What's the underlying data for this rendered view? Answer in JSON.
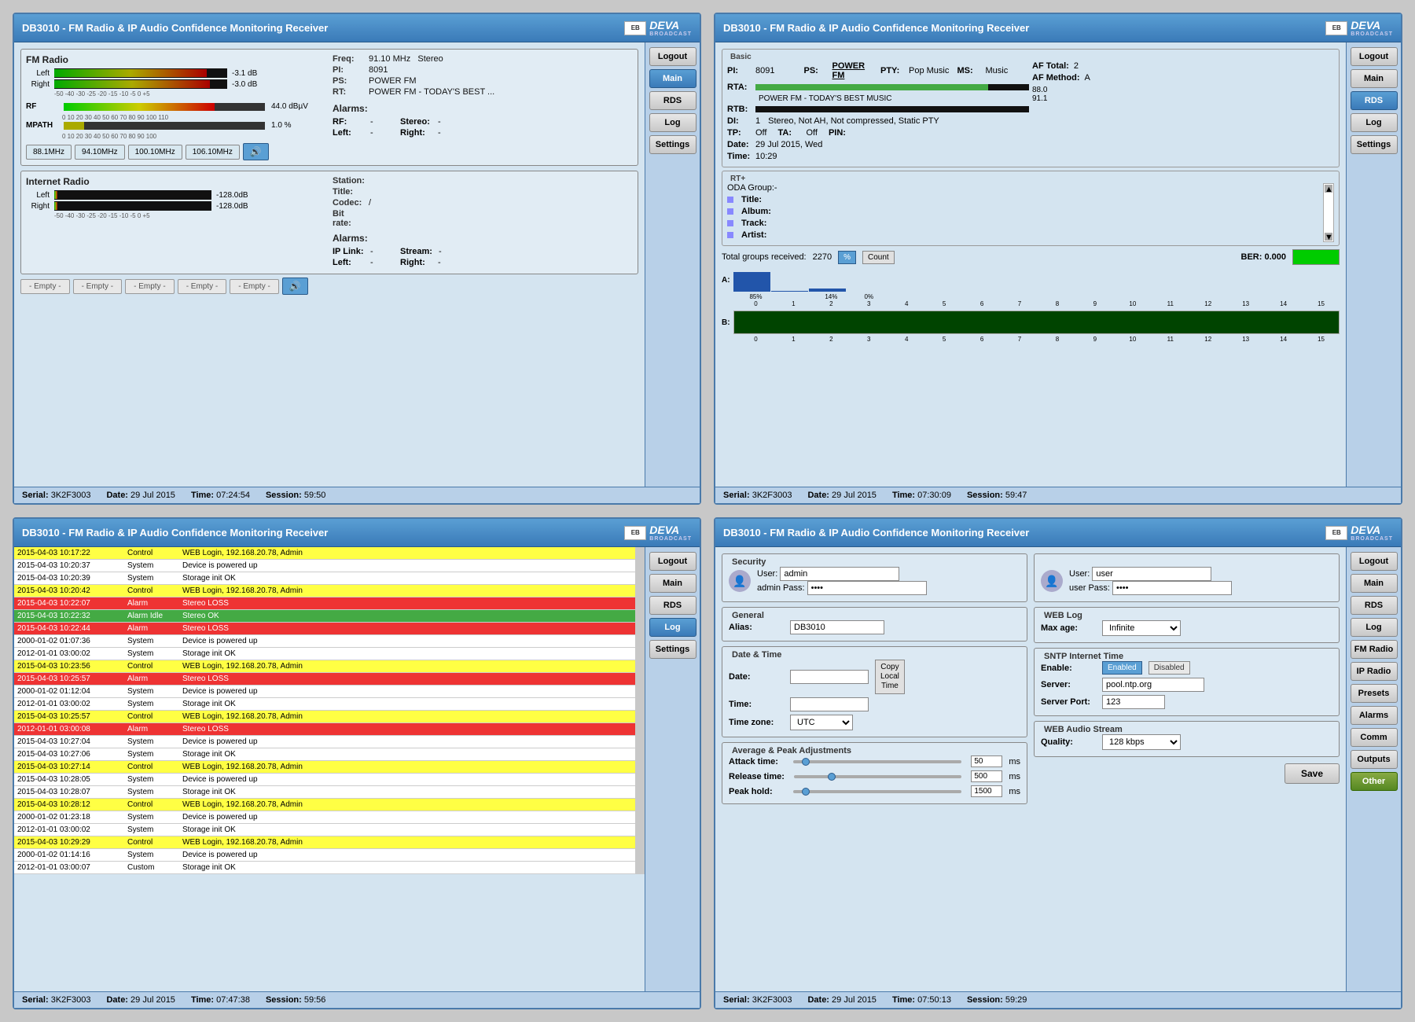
{
  "panels": {
    "panel1": {
      "title": "DB3010 - FM Radio & IP Audio Confidence Monitoring Receiver",
      "fm_radio": {
        "title": "FM Radio",
        "left_label": "Left",
        "right_label": "Right",
        "left_db": "-3.1 dB",
        "right_db": "-3.0 dB",
        "scale": "-50  -40  -30  -25  -20  -15  -10  -5  0  +5",
        "rf_label": "RF",
        "rf_value": "44.0 dBµV",
        "mpath_label": "MPATH",
        "mpath_value": "1.0 %",
        "rf_scale": "0  10  20  30  40  50  60  70  80  90  100  110",
        "mpath_scale": "0  10  20  30  40  50  60  70  80  90  100"
      },
      "freq_info": {
        "freq_label": "Freq:",
        "freq_val": "91.10 MHz",
        "stereo": "Stereo",
        "pi_label": "PI:",
        "pi_val": "8091",
        "ps_label": "PS:",
        "ps_val": "POWER FM",
        "rt_label": "RT:",
        "rt_val": "POWER FM - TODAY'S BEST ..."
      },
      "alarms": {
        "title": "Alarms:",
        "rf_label": "RF:",
        "rf_val": "-",
        "stereo_label": "Stereo:",
        "stereo_val": "-",
        "left_label": "Left:",
        "left_val": "-",
        "right_label": "Right:",
        "right_val": "-"
      },
      "freqs": [
        "88.1MHz",
        "94.10MHz",
        "100.10MHz",
        "106.10MHz"
      ],
      "internet_radio": {
        "title": "Internet Radio",
        "left_label": "Left",
        "right_label": "Right",
        "left_db": "-128.0dB",
        "right_db": "-128.0dB",
        "title_label": "Title:",
        "title_val": "",
        "codec_label": "Codec:",
        "codec_val": "/",
        "bitrate_label": "Bit rate:",
        "bitrate_val": "",
        "station_label": "Station:",
        "station_val": ""
      },
      "internet_alarms": {
        "title": "Alarms:",
        "iplink_label": "IP Link:",
        "iplink_val": "-",
        "stream_label": "Stream:",
        "stream_val": "-",
        "left_label": "Left:",
        "left_val": "-",
        "right_label": "Right:",
        "right_val": "-"
      },
      "empty_btns": [
        "- Empty -",
        "- Empty -",
        "- Empty -",
        "- Empty -",
        "- Empty -"
      ],
      "footer": {
        "serial_label": "Serial:",
        "serial_val": "3K2F3003",
        "date_label": "Date:",
        "date_val": "29 Jul 2015",
        "time_label": "Time:",
        "time_val": "07:24:54",
        "session_label": "Session:",
        "session_val": "59:50"
      },
      "sidebar": [
        "Logout",
        "Main",
        "RDS",
        "Log",
        "Settings"
      ]
    },
    "panel2": {
      "title": "DB3010 - FM Radio & IP Audio Confidence Monitoring Receiver",
      "basic": {
        "legend": "Basic",
        "pi_label": "PI:",
        "pi_val": "8091",
        "ps_label": "PS:",
        "ps_val": "POWER FM",
        "pty_label": "PTY:",
        "pty_val": "Pop Music",
        "ms_label": "MS:",
        "ms_val": "Music",
        "af_total_label": "AF Total:",
        "af_total_val": "2",
        "af_method_label": "AF Method:",
        "af_method_val": "A",
        "rta_label": "RTA:",
        "rta_val": "POWER FM - TODAY'S BEST MUSIC",
        "rtb_label": "RTB:",
        "rtb_val": "",
        "af1_val": "88.0",
        "af2_val": "91.1",
        "di_label": "DI:",
        "di_val": "1",
        "di_desc": "Stereo, Not AH, Not compressed, Static PTY",
        "tp_label": "TP:",
        "tp_val": "Off",
        "ta_label": "TA:",
        "ta_val": "Off",
        "pin_label": "PIN:",
        "pin_val": "",
        "date_label": "Date:",
        "date_val": "29 Jul 2015, Wed",
        "time_label": "Time:",
        "time_val": "10:29"
      },
      "rt_plus": {
        "legend": "RT+",
        "oda_label": "ODA Group:-",
        "title_label": "Title:",
        "title_val": "",
        "album_label": "Album:",
        "album_val": "",
        "track_label": "Track:",
        "track_val": "",
        "artist_label": "Artist:",
        "artist_val": ""
      },
      "groups": {
        "total_label": "Total groups received:",
        "total_val": "2270",
        "pct_btn": "%",
        "count_btn": "Count",
        "a_label": "A:",
        "a_bars": [
          85,
          0,
          14,
          0,
          0,
          0,
          0,
          0,
          0,
          0,
          0,
          0,
          0,
          0,
          0,
          0
        ],
        "a_labels": [
          "0",
          "1",
          "2",
          "3",
          "4",
          "5",
          "6",
          "7",
          "8",
          "9",
          "10",
          "11",
          "12",
          "13",
          "14",
          "15"
        ],
        "b_label": "B:",
        "b_bars": [
          0,
          0,
          0,
          0,
          0,
          0,
          0,
          0,
          0,
          0,
          0,
          0,
          0,
          0,
          0,
          0
        ],
        "ber_label": "BER:",
        "ber_val": "0.000"
      },
      "footer": {
        "serial_label": "Serial:",
        "serial_val": "3K2F3003",
        "date_label": "Date:",
        "date_val": "29 Jul 2015",
        "time_label": "Time:",
        "time_val": "07:30:09",
        "session_label": "Session:",
        "session_val": "59:47"
      },
      "sidebar": [
        "Logout",
        "Main",
        "RDS",
        "Log",
        "Settings"
      ]
    },
    "panel3": {
      "title": "DB3010 - FM Radio & IP Audio Confidence Monitoring Receiver",
      "log_entries": [
        {
          "date": "2015-04-03 10:17:22",
          "type": "Control",
          "msg": "WEB Login, 192.168.20.78, Admin",
          "color": "yellow"
        },
        {
          "date": "2015-04-03 10:20:37",
          "type": "System",
          "msg": "Device is powered up",
          "color": "normal"
        },
        {
          "date": "2015-04-03 10:20:39",
          "type": "System",
          "msg": "Storage init OK",
          "color": "normal"
        },
        {
          "date": "2015-04-03 10:20:42",
          "type": "Control",
          "msg": "WEB Login, 192.168.20.78, Admin",
          "color": "yellow"
        },
        {
          "date": "2015-04-03 10:22:07",
          "type": "Alarm",
          "msg": "Stereo LOSS",
          "color": "red"
        },
        {
          "date": "2015-04-03 10:22:32",
          "type": "Alarm Idle",
          "msg": "Stereo OK",
          "color": "green"
        },
        {
          "date": "2015-04-03 10:22:44",
          "type": "Alarm",
          "msg": "Stereo LOSS",
          "color": "red"
        },
        {
          "date": "2000-01-02 01:07:36",
          "type": "System",
          "msg": "Device is powered up",
          "color": "normal"
        },
        {
          "date": "2012-01-01 03:00:02",
          "type": "System",
          "msg": "Storage init OK",
          "color": "normal"
        },
        {
          "date": "2015-04-03 10:23:56",
          "type": "Control",
          "msg": "WEB Login, 192.168.20.78, Admin",
          "color": "yellow"
        },
        {
          "date": "2015-04-03 10:25:57",
          "type": "Alarm",
          "msg": "Stereo LOSS",
          "color": "red"
        },
        {
          "date": "2000-01-02 01:12:04",
          "type": "System",
          "msg": "Device is powered up",
          "color": "normal"
        },
        {
          "date": "2012-01-01 03:00:02",
          "type": "System",
          "msg": "Storage init OK",
          "color": "normal"
        },
        {
          "date": "2015-04-03 10:25:57",
          "type": "Control",
          "msg": "WEB Login, 192.168.20.78, Admin",
          "color": "yellow"
        },
        {
          "date": "2012-01-01 03:00:08",
          "type": "Alarm",
          "msg": "Stereo LOSS",
          "color": "red"
        },
        {
          "date": "2015-04-03 10:27:04",
          "type": "System",
          "msg": "Device is powered up",
          "color": "normal"
        },
        {
          "date": "2015-04-03 10:27:06",
          "type": "System",
          "msg": "Storage init OK",
          "color": "normal"
        },
        {
          "date": "2015-04-03 10:27:14",
          "type": "Control",
          "msg": "WEB Login, 192.168.20.78, Admin",
          "color": "yellow"
        },
        {
          "date": "2015-04-03 10:28:05",
          "type": "System",
          "msg": "Device is powered up",
          "color": "normal"
        },
        {
          "date": "2015-04-03 10:28:07",
          "type": "System",
          "msg": "Storage init OK",
          "color": "normal"
        },
        {
          "date": "2015-04-03 10:28:12",
          "type": "Control",
          "msg": "WEB Login, 192.168.20.78, Admin",
          "color": "yellow"
        },
        {
          "date": "2000-01-02 01:23:18",
          "type": "System",
          "msg": "Device is powered up",
          "color": "normal"
        },
        {
          "date": "2012-01-01 03:00:02",
          "type": "System",
          "msg": "Storage init OK",
          "color": "normal"
        },
        {
          "date": "2015-04-03 10:29:29",
          "type": "Control",
          "msg": "WEB Login, 192.168.20.78, Admin",
          "color": "yellow"
        },
        {
          "date": "2000-01-02 01:14:16",
          "type": "System",
          "msg": "Device is powered up",
          "color": "normal"
        },
        {
          "date": "2012-01-01 03:00:07",
          "type": "Custom",
          "msg": "Storage init OK",
          "color": "normal"
        }
      ],
      "footer": {
        "serial_label": "Serial:",
        "serial_val": "3K2F3003",
        "date_label": "Date:",
        "date_val": "29 Jul 2015",
        "time_label": "Time:",
        "time_val": "07:47:38",
        "session_label": "Session:",
        "session_val": "59:56"
      },
      "sidebar": [
        "Logout",
        "Main",
        "RDS",
        "Log",
        "Settings"
      ]
    },
    "panel4": {
      "title": "DB3010 - FM Radio & IP Audio Confidence Monitoring Receiver",
      "security": {
        "legend": "Security",
        "user1_label": "User:",
        "user1_val": "admin",
        "user2_label": "User:",
        "user2_val": "user",
        "pass1_label": "admin Pass:",
        "pass1_val": "••••",
        "pass2_label": "user Pass:",
        "pass2_val": "••••"
      },
      "general": {
        "legend": "General",
        "alias_label": "Alias:",
        "alias_val": "DB3010"
      },
      "web_log": {
        "legend": "WEB Log",
        "maxage_label": "Max age:",
        "maxage_val": "Infinite"
      },
      "date_time": {
        "legend": "Date & Time",
        "date_label": "Date:",
        "date_val": "",
        "time_label": "Time:",
        "time_val": "",
        "timezone_label": "Time zone:",
        "timezone_val": "UTC",
        "copy_btn": "Copy",
        "local_btn": "Local",
        "time_btn": "Time"
      },
      "sntp": {
        "legend": "SNTP Internet Time",
        "enable_label": "Enable:",
        "enabled_btn": "Enabled",
        "disabled_btn": "Disabled",
        "server_label": "Server:",
        "server_val": "pool.ntp.org",
        "port_label": "Server Port:",
        "port_val": "123"
      },
      "avg_peak": {
        "legend": "Average & Peak Adjustments",
        "attack_label": "Attack time:",
        "attack_val": "50",
        "attack_unit": "ms",
        "release_label": "Release time:",
        "release_val": "500",
        "release_unit": "ms",
        "peak_label": "Peak hold:",
        "peak_val": "1500",
        "peak_unit": "ms"
      },
      "web_audio": {
        "legend": "WEB Audio Stream",
        "quality_label": "Quality:",
        "quality_val": "128 kbps"
      },
      "save_btn": "Save",
      "footer": {
        "serial_label": "Serial:",
        "serial_val": "3K2F3003",
        "date_label": "Date:",
        "date_val": "29 Jul 2015",
        "time_label": "Time:",
        "time_val": "07:50:13",
        "session_label": "Session:",
        "session_val": "59:29"
      },
      "sidebar": [
        "Logout",
        "Main",
        "RDS",
        "Log",
        "FM Radio",
        "IP Radio",
        "Presets",
        "Alarms",
        "Comm",
        "Outputs",
        "Other"
      ]
    }
  }
}
